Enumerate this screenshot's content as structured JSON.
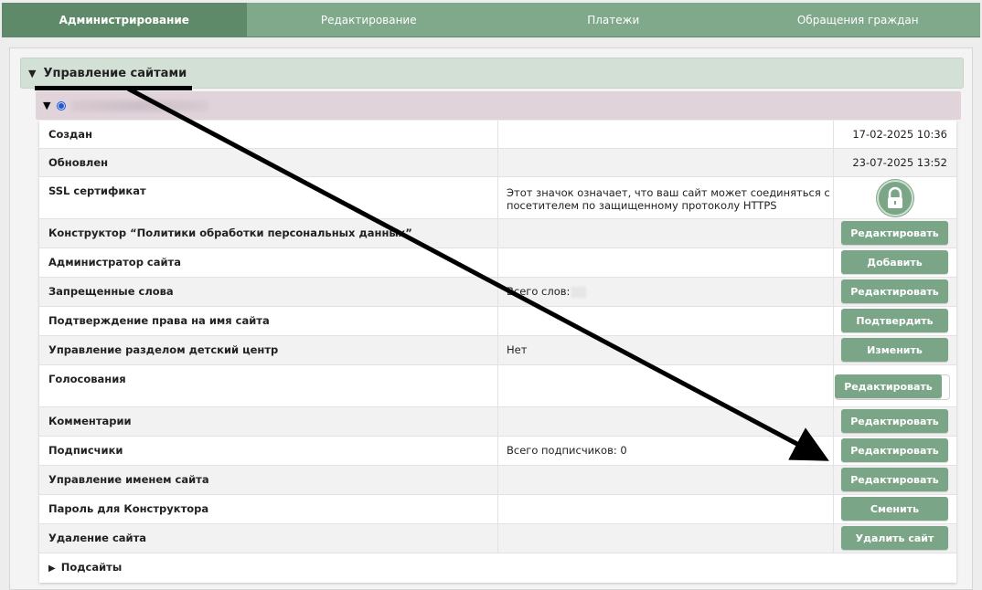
{
  "tabs": [
    "Администрирование",
    "Редактирование",
    "Платежи",
    "Обращения граждан"
  ],
  "panel_title": "Управление сайтами",
  "rows": [
    {
      "label": "Создан",
      "mid": "",
      "value": "17-02-2025 10:36"
    },
    {
      "label": "Обновлен",
      "mid": "",
      "value": "23-07-2025 13:52"
    },
    {
      "label": "SSL сертификат",
      "mid": "Этот значок означает, что ваш сайт может соединяться с посетителем по защищенному протоколу HTTPS",
      "icon": "lock-icon"
    },
    {
      "label": "Конструктор “Политики обработки персональных данных”",
      "mid": "",
      "button": "Редактировать"
    },
    {
      "label": "Администратор сайта",
      "mid": "",
      "button": "Добавить"
    },
    {
      "label": "Запрещенные слова",
      "mid": "Всего слов:",
      "button": "Редактировать"
    },
    {
      "label": "Подтверждение права на имя сайта",
      "mid": "",
      "button": "Подтвердить"
    },
    {
      "label": "Управление разделом детский центр",
      "mid": "Нет",
      "button": "Изменить"
    },
    {
      "label": "Голосования",
      "mid": "",
      "button": "Редактировать"
    },
    {
      "label": "Комментарии",
      "mid": "",
      "button": "Редактировать"
    },
    {
      "label": "Подписчики",
      "mid": "Всего подписчиков: 0",
      "button": "Редактировать"
    },
    {
      "label": "Управление именем сайта",
      "mid": "",
      "button": "Редактировать"
    },
    {
      "label": "Пароль для Конструктора",
      "mid": "",
      "button": "Сменить"
    },
    {
      "label": "Удаление сайта",
      "mid": "",
      "button": "Удалить сайт"
    }
  ],
  "subsites_label": "Подсайты",
  "colors": {
    "accent": "#7ba587",
    "tab_active": "#5f8a6a",
    "site_header": "#e1d3da"
  }
}
